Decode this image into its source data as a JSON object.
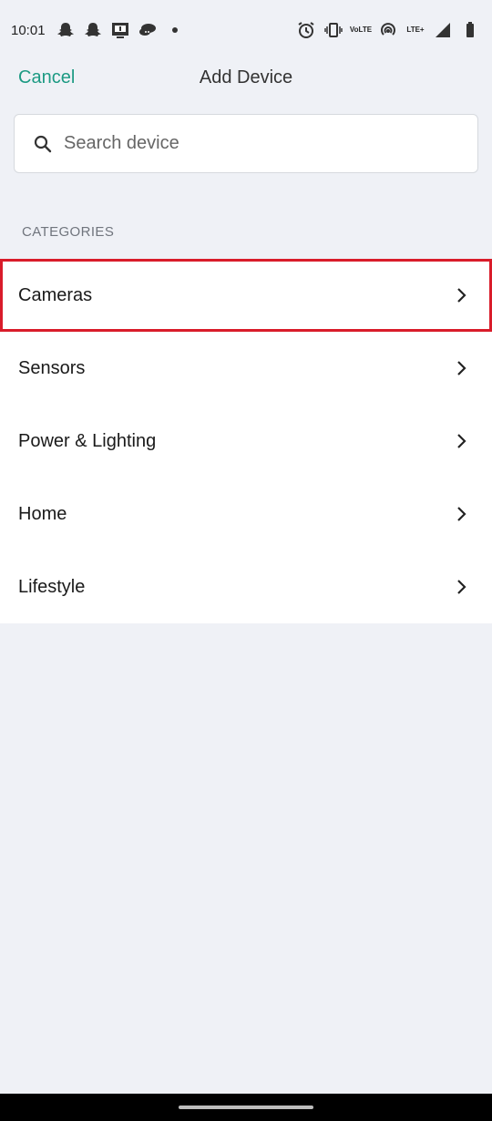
{
  "status_bar": {
    "time": "10:01",
    "left_icons": [
      "snapchat-icon",
      "snapchat-icon",
      "screen-share-icon",
      "chat-bubbles-icon",
      "dot-icon"
    ],
    "right_icons": [
      "alarm-icon",
      "vibrate-icon",
      "volte-icon",
      "hotspot-icon",
      "lte-signal-icon",
      "signal-icon",
      "battery-icon"
    ],
    "volte_label": "VoLTE",
    "lte_label": "LTE+"
  },
  "nav": {
    "cancel_label": "Cancel",
    "title": "Add Device"
  },
  "search": {
    "placeholder": "Search device",
    "value": ""
  },
  "categories": {
    "header": "CATEGORIES",
    "items": [
      {
        "label": "Cameras",
        "highlighted": true
      },
      {
        "label": "Sensors"
      },
      {
        "label": "Power & Lighting"
      },
      {
        "label": "Home"
      },
      {
        "label": "Lifestyle"
      }
    ]
  },
  "colors": {
    "accent": "#1c9a83",
    "highlight": "#d91c2a",
    "background": "#eff1f6"
  }
}
